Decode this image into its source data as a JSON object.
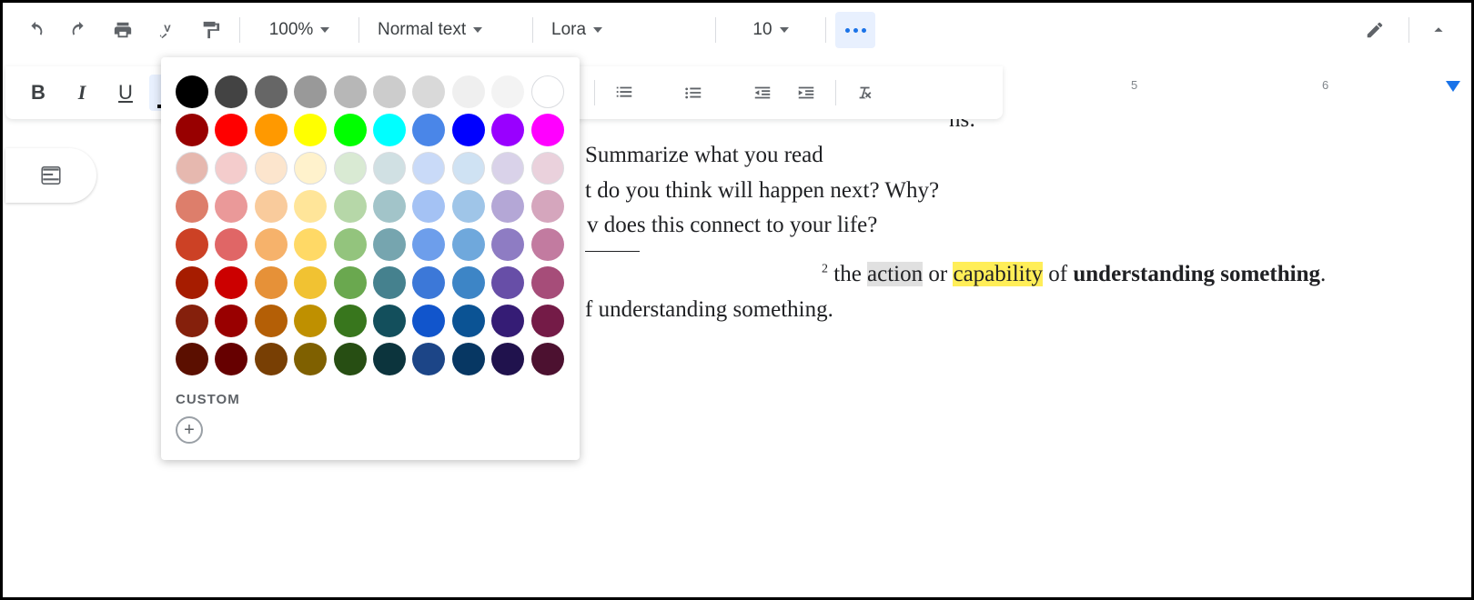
{
  "toolbar": {
    "zoom": "100%",
    "paragraph_style": "Normal text",
    "font": "Lora",
    "font_size": "10"
  },
  "ruler": {
    "marks": [
      "5",
      "6"
    ]
  },
  "document": {
    "line0_suffix": "ns:",
    "line1": "Summarize what you read",
    "line2": "t do you think will happen next? Why?",
    "line3": "v does this connect to your life?",
    "def_sup": "2",
    "def_pre": " the ",
    "def_action": "action",
    "def_or": " or ",
    "def_capability": "capability",
    "def_of": " of ",
    "def_bold": "understanding something",
    "def_period": ".",
    "line5": "f understanding something."
  },
  "color_picker": {
    "custom_label": "CUSTOM",
    "swatches": [
      [
        "#000000",
        "#434343",
        "#666666",
        "#999999",
        "#b7b7b7",
        "#cccccc",
        "#d9d9d9",
        "#efefef",
        "#f3f3f3",
        "#ffffff"
      ],
      [
        "#980000",
        "#ff0000",
        "#ff9900",
        "#ffff00",
        "#00ff00",
        "#00ffff",
        "#4a86e8",
        "#0000ff",
        "#9900ff",
        "#ff00ff"
      ],
      [
        "#e6b8af",
        "#f4cccc",
        "#fce5cd",
        "#fff2cc",
        "#d9ead3",
        "#d0e0e3",
        "#c9daf8",
        "#cfe2f3",
        "#d9d2e9",
        "#ead1dc"
      ],
      [
        "#dd7e6b",
        "#ea9999",
        "#f9cb9c",
        "#ffe599",
        "#b6d7a8",
        "#a2c4c9",
        "#a4c2f4",
        "#9fc5e8",
        "#b4a7d6",
        "#d5a6bd"
      ],
      [
        "#cc4125",
        "#e06666",
        "#f6b26b",
        "#ffd966",
        "#93c47d",
        "#76a5af",
        "#6d9eeb",
        "#6fa8dc",
        "#8e7cc3",
        "#c27ba0"
      ],
      [
        "#a61c00",
        "#cc0000",
        "#e69138",
        "#f1c232",
        "#6aa84f",
        "#45818e",
        "#3c78d8",
        "#3d85c6",
        "#674ea7",
        "#a64d79"
      ],
      [
        "#85200c",
        "#990000",
        "#b45f06",
        "#bf9000",
        "#38761d",
        "#134f5c",
        "#1155cc",
        "#0b5394",
        "#351c75",
        "#741b47"
      ],
      [
        "#5b0f00",
        "#660000",
        "#783f04",
        "#7f6000",
        "#274e13",
        "#0c343d",
        "#1c4587",
        "#073763",
        "#20124d",
        "#4c1130"
      ]
    ]
  }
}
